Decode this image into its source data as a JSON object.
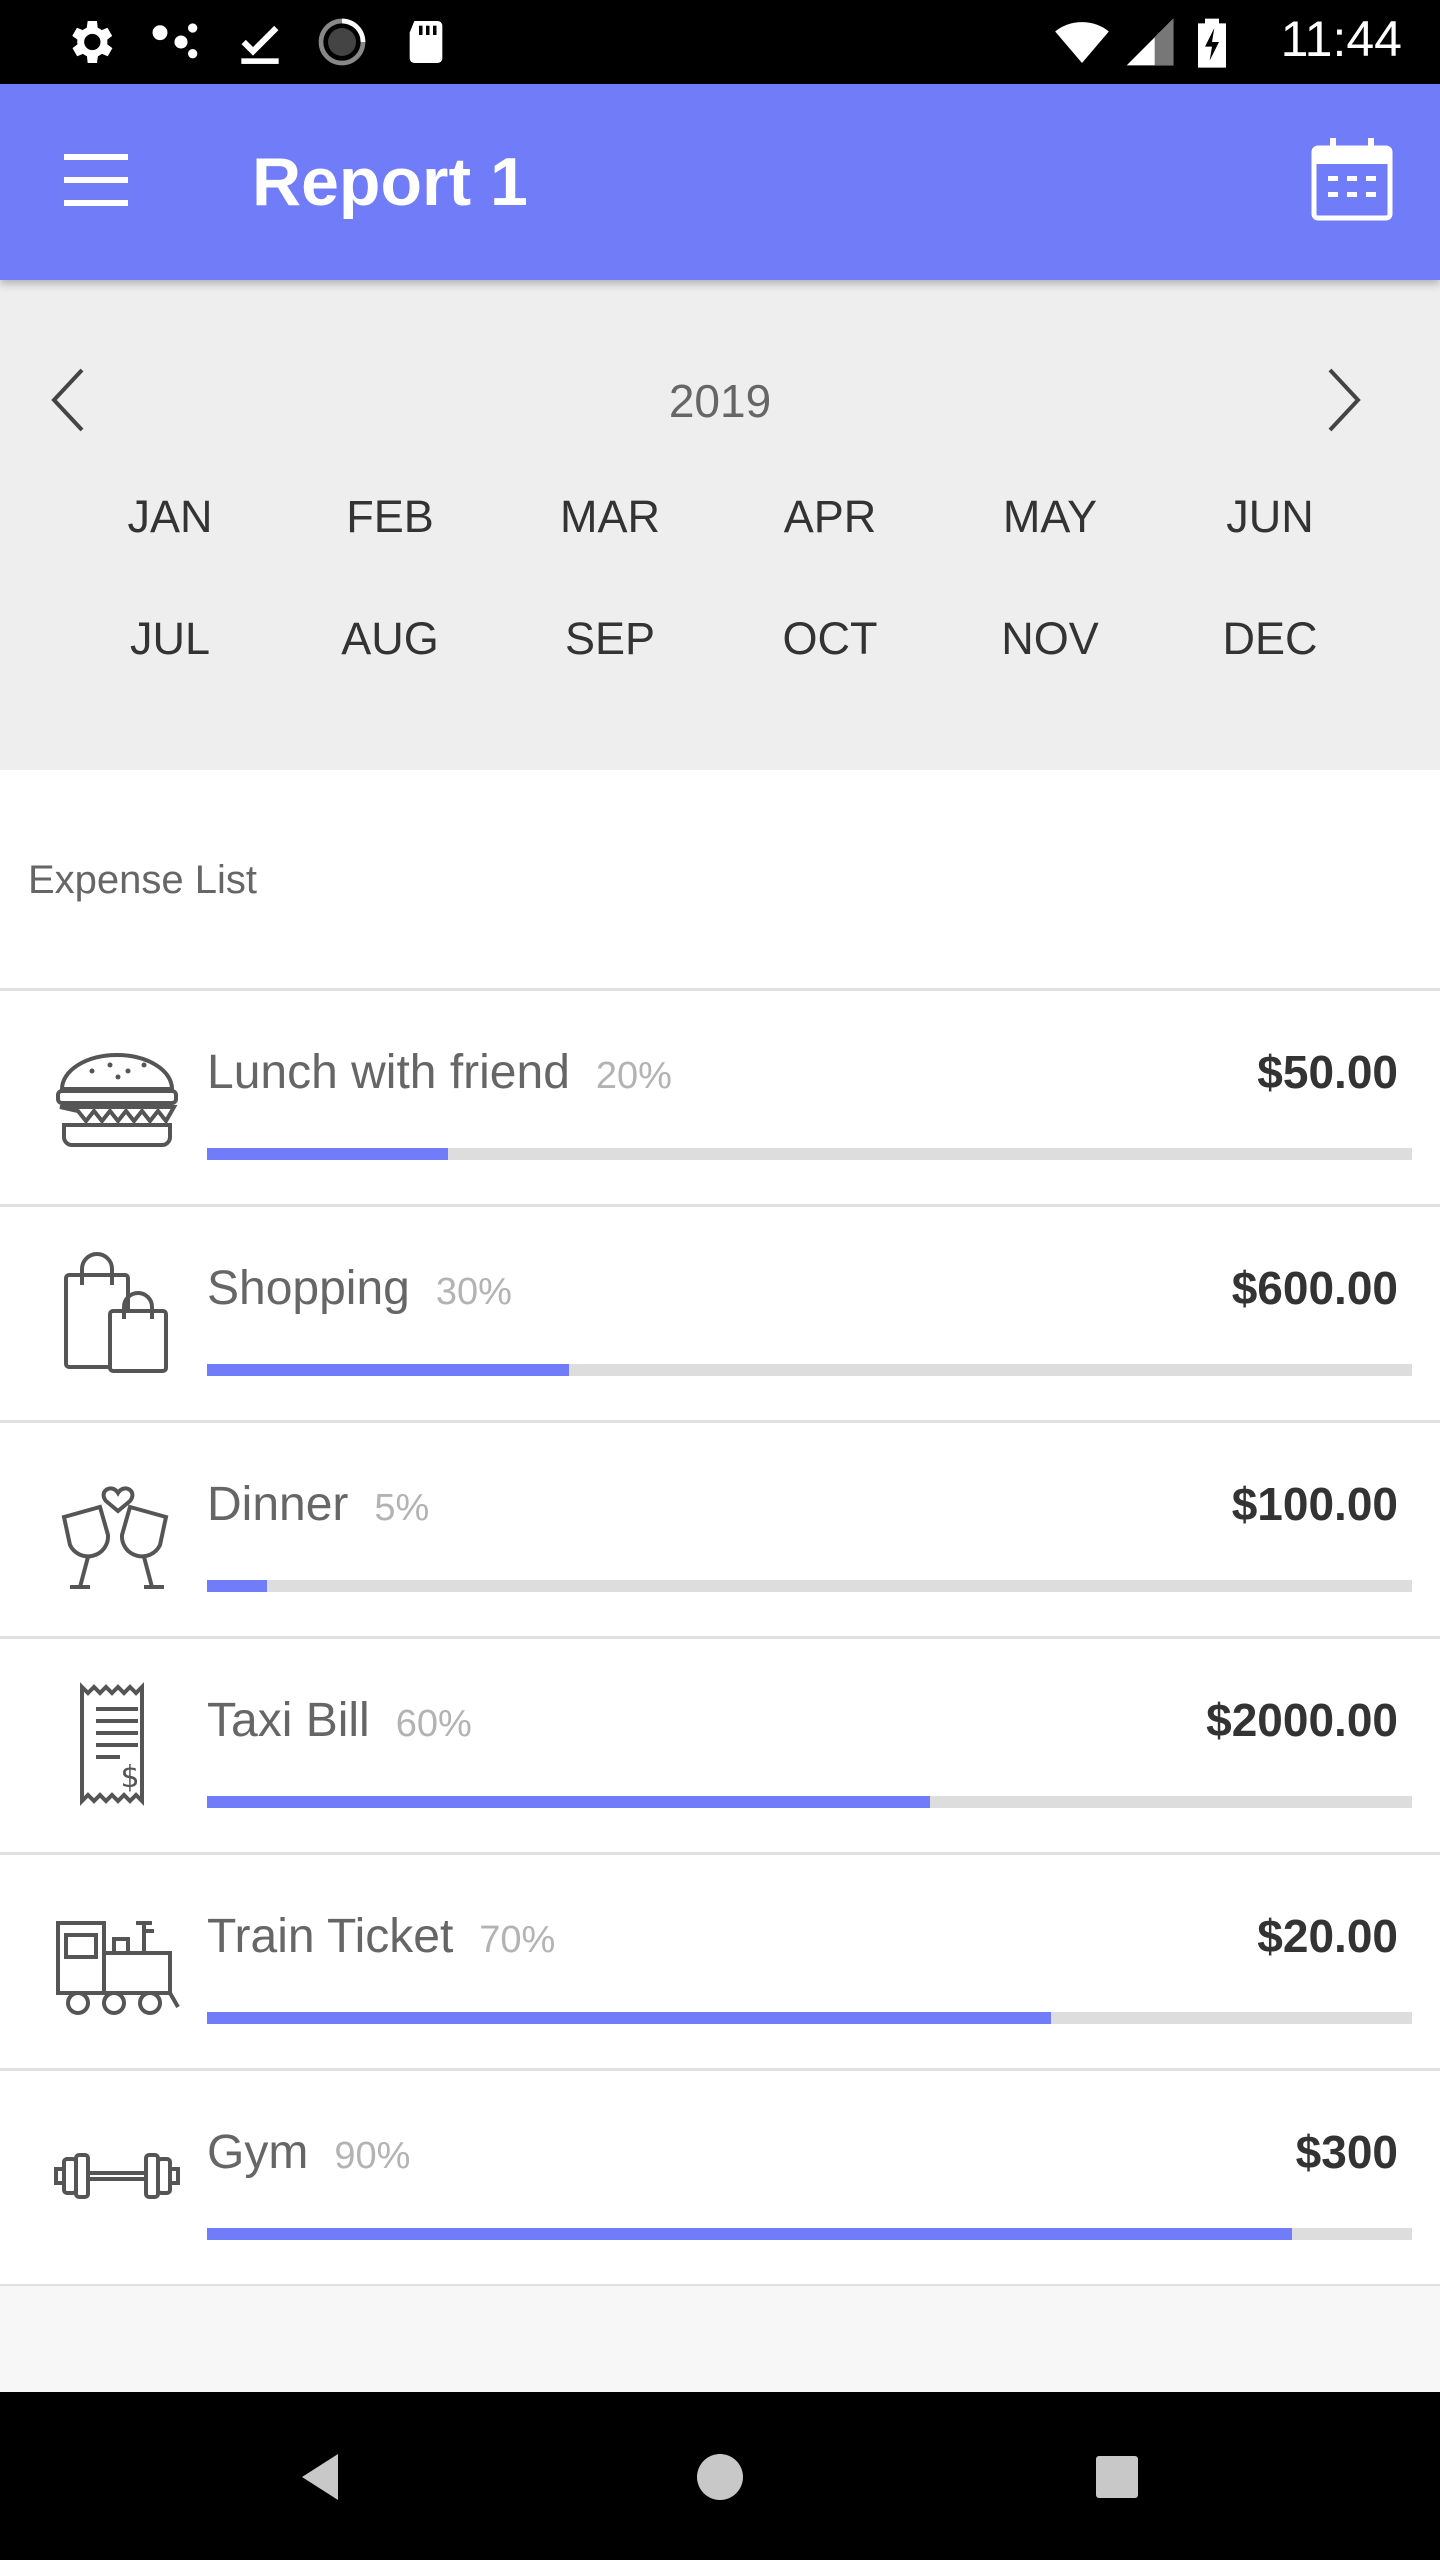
{
  "status_bar": {
    "time": "11:44",
    "icons": [
      "settings-icon",
      "dots-icon",
      "download-done-icon",
      "loading-icon",
      "sd-card-icon",
      "wifi-icon",
      "signal-icon",
      "battery-charging-icon"
    ]
  },
  "app_bar": {
    "title": "Report 1",
    "menu_icon": "menu-icon",
    "calendar_icon": "calendar-icon",
    "color": "#717cf9"
  },
  "picker": {
    "year": "2019",
    "months": [
      "JAN",
      "FEB",
      "MAR",
      "APR",
      "MAY",
      "JUN",
      "JUL",
      "AUG",
      "SEP",
      "OCT",
      "NOV",
      "DEC"
    ]
  },
  "expense_list": {
    "title": "Expense List",
    "items": [
      {
        "name": "Lunch with friend",
        "percent_label": "20%",
        "amount": "$50.00",
        "icon": "burger-icon",
        "progress": 0.2
      },
      {
        "name": "Shopping",
        "percent_label": "30%",
        "amount": "$600.00",
        "icon": "shopping-bags-icon",
        "progress": 0.3
      },
      {
        "name": "Dinner",
        "percent_label": "5%",
        "amount": "$100.00",
        "icon": "wine-glasses-icon",
        "progress": 0.05
      },
      {
        "name": "Taxi Bill",
        "percent_label": "60%",
        "amount": "$2000.00",
        "icon": "receipt-icon",
        "progress": 0.6
      },
      {
        "name": "Train Ticket",
        "percent_label": "70%",
        "amount": "$20.00",
        "icon": "train-icon",
        "progress": 0.7
      },
      {
        "name": "Gym",
        "percent_label": "90%",
        "amount": "$300",
        "icon": "dumbbell-icon",
        "progress": 0.9
      }
    ]
  },
  "nav_bar": {
    "icons": [
      "back-icon",
      "home-icon",
      "recents-icon"
    ]
  }
}
